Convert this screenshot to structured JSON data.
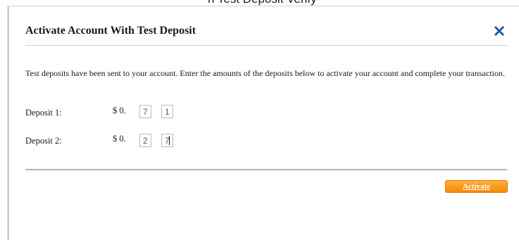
{
  "page": {
    "top_fragment": "h Test Deposit Verify"
  },
  "dialog": {
    "title": "Activate Account With Test Deposit",
    "close_icon": "close-x-icon",
    "instructions": "Test deposits have been sent to your account. Enter the amounts of the deposits below to activate your account and complete your transaction.",
    "currency_prefix": "$ 0.",
    "deposits": [
      {
        "label": "Deposit 1:",
        "digit1": "7",
        "digit2": "1"
      },
      {
        "label": "Deposit 2:",
        "digit1": "2",
        "digit2": "7"
      }
    ],
    "activate_label": "Activate",
    "colors": {
      "accent_orange": "#f58a00",
      "close_blue": "#1f5fa8"
    }
  }
}
